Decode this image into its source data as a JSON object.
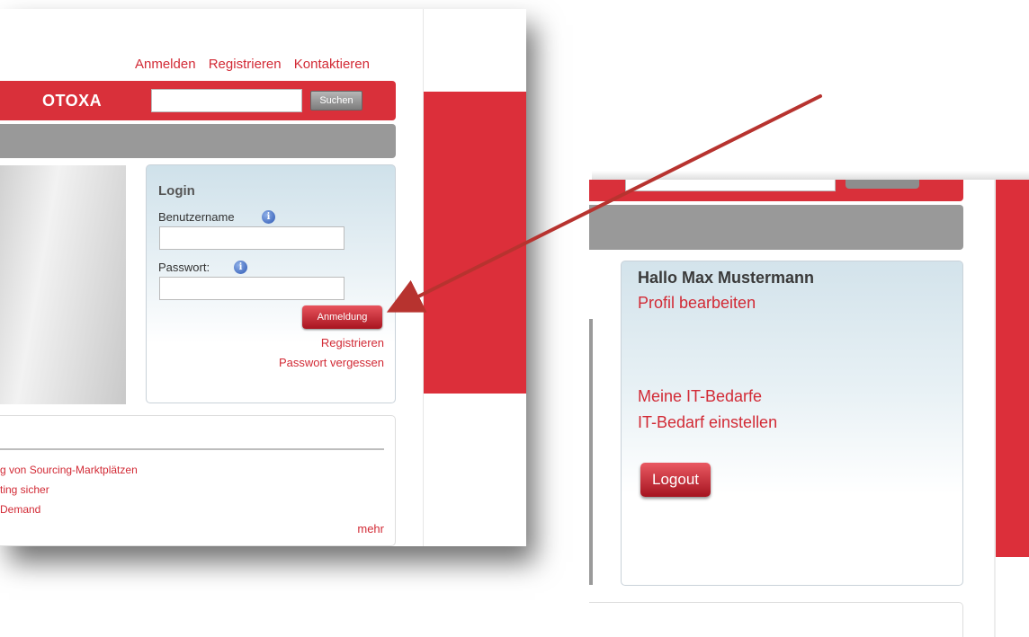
{
  "left_screen": {
    "top_nav": [
      {
        "label": "Anmelden"
      },
      {
        "label": "Registrieren"
      },
      {
        "label": "Kontaktieren"
      }
    ],
    "header": {
      "logo_text": "OTOXA",
      "search_value": "",
      "search_button": "Suchen"
    },
    "login": {
      "title": "Login",
      "username_label": "Benutzername",
      "username_value": "",
      "password_label": "Passwort:",
      "password_value": "",
      "info_glyph": "i",
      "submit_label": "Anmeldung",
      "register_link": "Registrieren",
      "forgot_link": "Passwort vergessen"
    },
    "news": {
      "items": [
        "g von Sourcing-Marktplätzen",
        "ting sicher",
        "Demand"
      ],
      "more_link": "mehr"
    }
  },
  "right_screen": {
    "greeting": "Hallo Max Mustermann",
    "profile_link": "Profil bearbeiten",
    "needs_link": "Meine IT-Bedarfe",
    "add_need_link": "IT-Bedarf einstellen",
    "logout_label": "Logout"
  },
  "colors": {
    "brand_red": "#d9303a",
    "link_red": "#d22a35",
    "gray_bar": "#999999",
    "arrow": "#b7332f"
  },
  "icons": {
    "info": "info-icon",
    "arrow": "callout-arrow-icon"
  }
}
